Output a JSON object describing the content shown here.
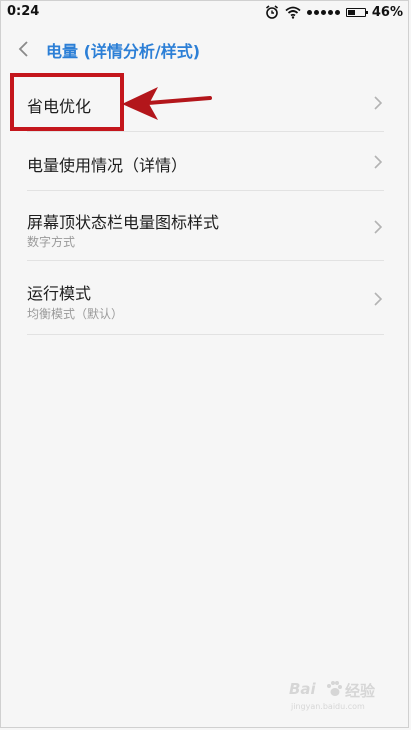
{
  "status_bar": {
    "time": "0:24",
    "battery_percent": "46%",
    "battery_level": 0.46,
    "icons": [
      "alarm-icon",
      "wifi-icon",
      "signal-icon",
      "battery-icon"
    ]
  },
  "header": {
    "title": "电量 (详情分析/样式)",
    "accent_color": "#2c7fd6"
  },
  "settings": {
    "items": [
      {
        "title": "省电优化"
      },
      {
        "title": "电量使用情况（详情）"
      },
      {
        "title": "屏幕顶状态栏电量图标样式",
        "subtitle": "数字方式"
      },
      {
        "title": "运行模式",
        "subtitle": "均衡模式（默认）"
      }
    ]
  },
  "annotation": {
    "color": "#c4161c"
  },
  "watermark": {
    "brand": "Bai",
    "brand2": "经验",
    "url": "jingyan.baidu.com"
  }
}
